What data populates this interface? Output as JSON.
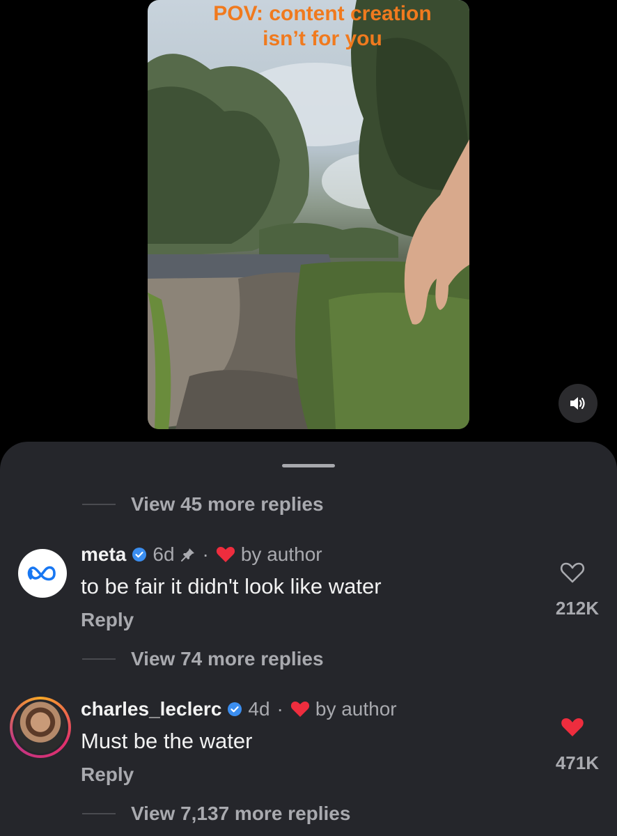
{
  "video": {
    "caption_line1": "POV: content creation",
    "caption_line2": "isn’t for you",
    "sound_icon": "speaker-icon"
  },
  "thread": {
    "top_replies": "View 45 more replies"
  },
  "comments": [
    {
      "username": "meta",
      "time": "6d",
      "pinned": true,
      "author_badge": "by author",
      "text": "to be fair it didn't look like water",
      "reply_label": "Reply",
      "likes": "212K",
      "liked": false,
      "more_replies": "View 74 more replies"
    },
    {
      "username": "charles_leclerc",
      "time": "4d",
      "pinned": false,
      "author_badge": "by author",
      "text": "Must be the water",
      "reply_label": "Reply",
      "likes": "471K",
      "liked": true,
      "more_replies": "View 7,137 more replies"
    }
  ],
  "colors": {
    "sheet_bg": "#25262b",
    "caption": "#f07a1e",
    "heart": "#ee2d3e",
    "verified": "#3b8ef0",
    "muted_text": "#a9aaaf"
  }
}
